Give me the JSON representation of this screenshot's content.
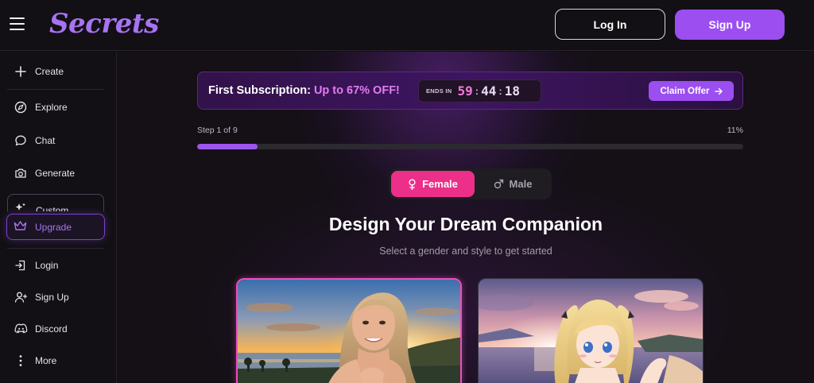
{
  "app": {
    "logo_text": "Secrets"
  },
  "header": {
    "login_label": "Log In",
    "signup_label": "Sign Up"
  },
  "sidebar": {
    "items": [
      {
        "label": "Create",
        "icon": "plus-icon"
      },
      {
        "label": "Explore",
        "icon": "compass-icon"
      },
      {
        "label": "Chat",
        "icon": "chat-bubble-icon"
      },
      {
        "label": "Generate",
        "icon": "camera-icon"
      },
      {
        "label": "Custom",
        "icon": "sparkles-icon"
      },
      {
        "label": "Upgrade",
        "icon": "crown-icon"
      },
      {
        "label": "Login",
        "icon": "login-icon"
      },
      {
        "label": "Sign Up",
        "icon": "user-plus-icon"
      },
      {
        "label": "Discord",
        "icon": "discord-icon"
      },
      {
        "label": "More",
        "icon": "more-vertical-icon"
      }
    ]
  },
  "promo": {
    "lead": "First Subscription:",
    "highlight": "Up to 67% OFF!",
    "ends_label": "ENDS IN",
    "countdown": {
      "h": "59",
      "m": "44",
      "s": "18"
    },
    "cta": "Claim Offer"
  },
  "progress": {
    "step_label": "Step 1 of 9",
    "percent_label": "11%",
    "value": 0.11
  },
  "gender": {
    "female_label": "Female",
    "male_label": "Male",
    "selected": "Female"
  },
  "content": {
    "headline": "Design Your Dream Companion",
    "subline": "Select a gender and style to get started"
  },
  "styles": [
    {
      "name": "realistic",
      "selected": true
    },
    {
      "name": "anime",
      "selected": false
    }
  ],
  "colors": {
    "accent": "#9c4ef0",
    "pink": "#ec2f89",
    "highlight": "#e27cf0",
    "background": "#121014"
  }
}
